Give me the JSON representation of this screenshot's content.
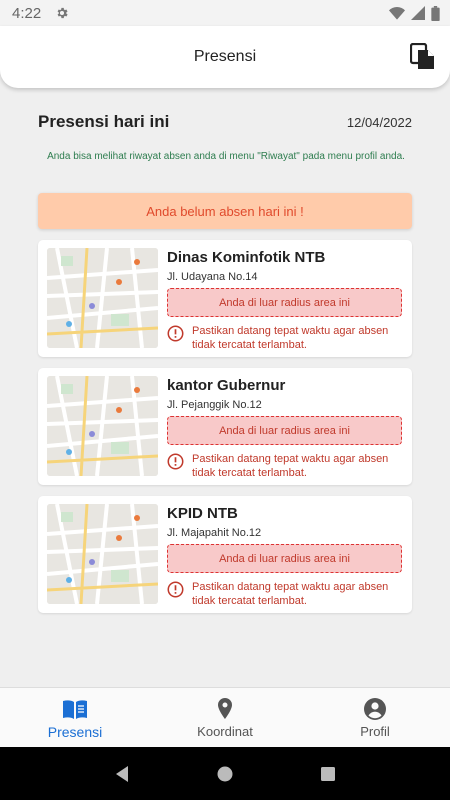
{
  "status_bar": {
    "time": "4:22"
  },
  "header": {
    "title": "Presensi"
  },
  "section": {
    "title": "Presensi hari ini",
    "date": "12/04/2022"
  },
  "info": {
    "text": "Anda bisa melihat riwayat absen anda di menu \"Riwayat\" pada menu profil anda."
  },
  "alert": {
    "text": "Anda belum absen hari ini !"
  },
  "locations": [
    {
      "name": "Dinas Kominfotik NTB",
      "address": "Jl. Udayana No.14",
      "radius_status": "Anda di luar radius area ini",
      "warning": "Pastikan datang tepat waktu agar absen tidak tercatat terlambat."
    },
    {
      "name": "kantor Gubernur",
      "address": "Jl. Pejanggik No.12",
      "radius_status": "Anda di luar radius area ini",
      "warning": "Pastikan datang tepat waktu agar absen tidak tercatat terlambat."
    },
    {
      "name": "KPID NTB",
      "address": "Jl. Majapahit No.12",
      "radius_status": "Anda di luar radius area ini",
      "warning": "Pastikan datang tepat waktu agar absen tidak tercatat terlambat."
    }
  ],
  "bottom_nav": [
    {
      "label": "Presensi",
      "icon": "book-icon",
      "active": true
    },
    {
      "label": "Koordinat",
      "icon": "location-pin-icon",
      "active": false
    },
    {
      "label": "Profil",
      "icon": "account-circle-icon",
      "active": false
    }
  ],
  "colors": {
    "accent": "#1b6fd4",
    "alert_bg": "#ffcbaa",
    "alert_text": "#e04a2c",
    "error": "#c0392b",
    "info_text": "#2e7d4f"
  }
}
